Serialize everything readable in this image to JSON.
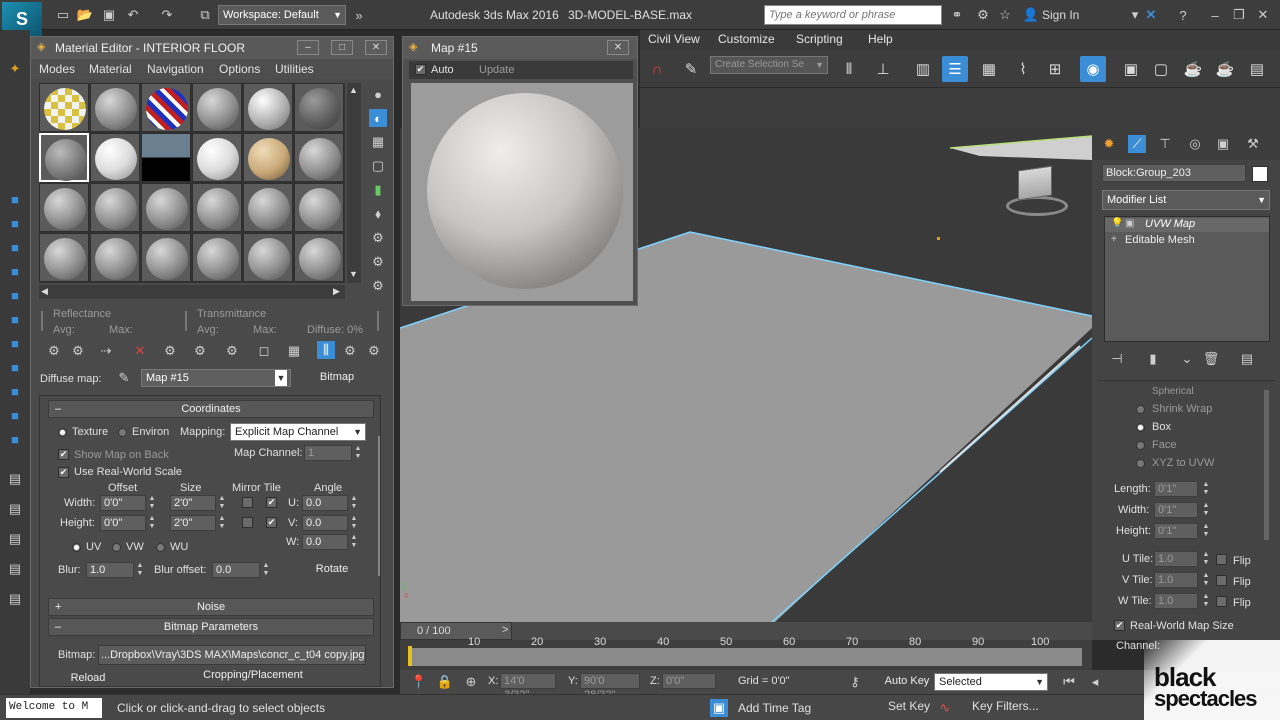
{
  "titlebar": {
    "workspace": "Workspace: Default",
    "title": "Autodesk 3ds Max 2016",
    "file": "3D-MODEL-BASE.max",
    "search_placeholder": "Type a keyword or phrase",
    "signin": "Sign In"
  },
  "menubar": {
    "items": [
      "Civil View",
      "Customize",
      "Scripting",
      "Help"
    ]
  },
  "toolbar": {
    "selection_set_placeholder": "Create Selection Se"
  },
  "material_editor": {
    "title": "Material Editor - INTERIOR FLOOR",
    "menus": [
      "Modes",
      "Material",
      "Navigation",
      "Options",
      "Utilities"
    ],
    "reflectance": {
      "label": "Reflectance",
      "avg": "Avg:",
      "max": "Max:"
    },
    "transmittance": {
      "label": "Transmittance",
      "avg": "Avg:",
      "max": "Max:",
      "diffuse": "Diffuse: 0%"
    },
    "diffuse_map_label": "Diffuse map:",
    "diffuse_map_value": "Map #15",
    "map_type": "Bitmap",
    "coordinates": {
      "header": "Coordinates",
      "texture": "Texture",
      "environ": "Environ",
      "mapping_label": "Mapping:",
      "mapping_value": "Explicit Map Channel",
      "show_map_on_back": "Show Map on Back",
      "map_channel_label": "Map Channel:",
      "map_channel_value": "1",
      "use_real_world": "Use Real-World Scale",
      "col_offset": "Offset",
      "col_size": "Size",
      "col_mirror_tile": "Mirror Tile",
      "col_angle": "Angle",
      "width_label": "Width:",
      "height_label": "Height:",
      "width_offset": "0'0\"",
      "width_size": "2'0\"",
      "height_offset": "0'0\"",
      "height_size": "2'0\"",
      "u_label": "U:",
      "v_label": "V:",
      "w_label": "W:",
      "u_angle": "0.0",
      "v_angle": "0.0",
      "w_angle": "0.0",
      "uv": "UV",
      "vw": "VW",
      "wu": "WU",
      "blur_label": "Blur:",
      "blur_value": "1.0",
      "blur_offset_label": "Blur offset:",
      "blur_offset_value": "0.0",
      "rotate": "Rotate"
    },
    "noise": {
      "header": "Noise"
    },
    "bitmap_params": {
      "header": "Bitmap Parameters",
      "bitmap_label": "Bitmap:",
      "bitmap_path": "...Dropbox\\Vray\\3DS MAX\\Maps\\concr_c_t04 copy.jpg",
      "reload": "Reload",
      "cropping": "Cropping/Placement"
    }
  },
  "map_window": {
    "title": "Map #15",
    "auto": "Auto",
    "update": "Update"
  },
  "command_panel": {
    "object_name": "Block:Group_203",
    "modifier_list": "Modifier List",
    "stack": [
      "UVW Map",
      "Editable Mesh"
    ],
    "mapping_options": [
      "Spherical",
      "Shrink Wrap",
      "Box",
      "Face",
      "XYZ to UVW"
    ],
    "selected_mapping": "Box",
    "length_label": "Length:",
    "width_label": "Width:",
    "height_label": "Height:",
    "length_value": "0'1\"",
    "width_value": "0'1\"",
    "height_value": "0'1\"",
    "utile_label": "U Tile:",
    "vtile_label": "V Tile:",
    "wtile_label": "W Tile:",
    "tile_value": "1.0",
    "flip": "Flip",
    "real_world": "Real-World Map Size",
    "channel": "Channel:"
  },
  "timeline": {
    "frame": "0 / 100",
    "ticks": [
      "10",
      "20",
      "30",
      "40",
      "50",
      "60",
      "70",
      "80",
      "90",
      "100"
    ]
  },
  "statusbar": {
    "x_label": "X:",
    "x_value": "14'0 3/32\"",
    "y_label": "Y:",
    "y_value": "90'0 28/32\"",
    "z_label": "Z:",
    "z_value": "0'0\"",
    "grid": "Grid = 0'0\"",
    "auto_key": "Auto Key",
    "key_mode": "Selected",
    "set_key": "Set Key",
    "key_filters": "Key Filters...",
    "add_time_tag": "Add Time Tag",
    "prompt": "Click or click-and-drag to select objects",
    "listener": "Welcome to M"
  },
  "watermark": {
    "line1": "black",
    "line2": "spectacles"
  },
  "colors": {
    "accent": "#3b8ed6",
    "selection_edge": "#7fd4ff",
    "viewport_bg": "#3a3a3a"
  }
}
